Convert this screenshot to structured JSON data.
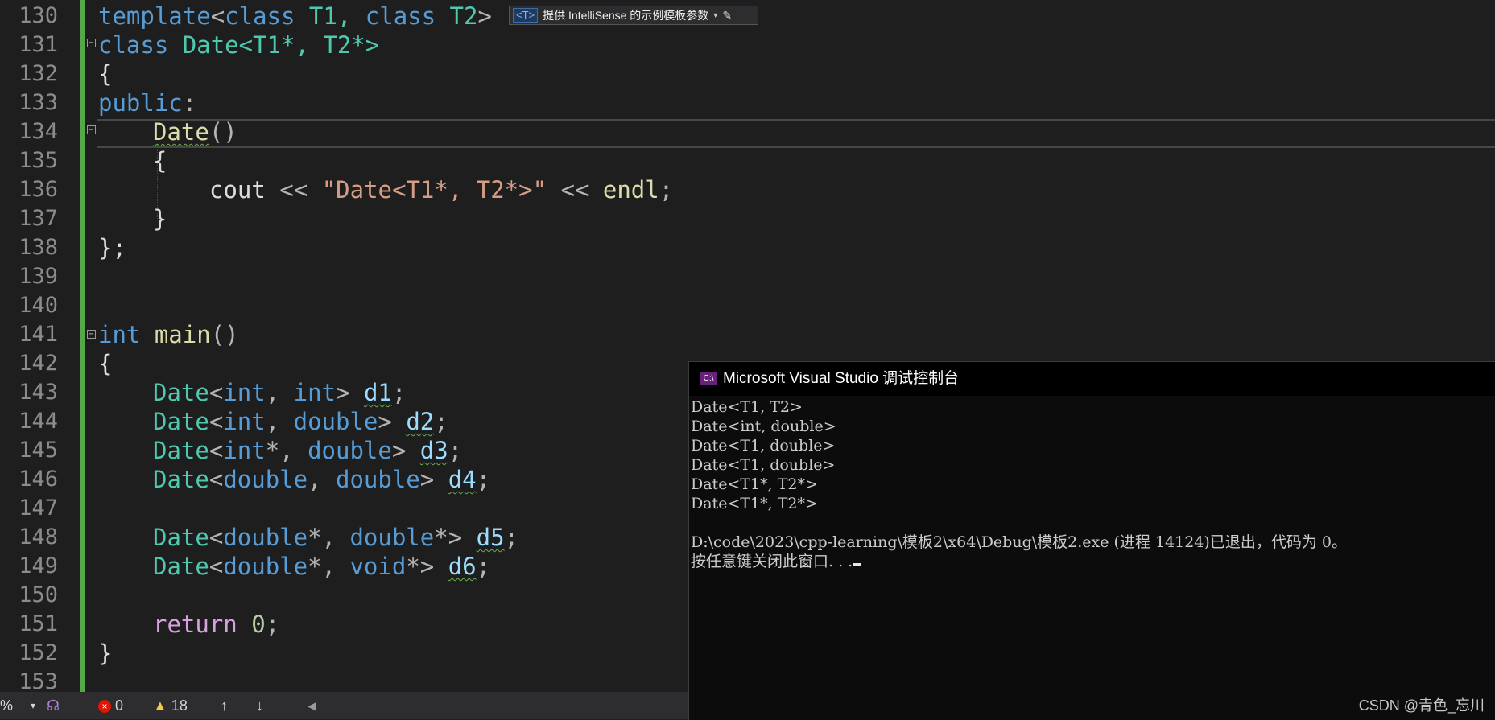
{
  "editor": {
    "line_numbers": [
      "130",
      "131",
      "132",
      "133",
      "134",
      "135",
      "136",
      "137",
      "138",
      "139",
      "140",
      "141",
      "142",
      "143",
      "144",
      "145",
      "146",
      "147",
      "148",
      "149",
      "150",
      "151",
      "152",
      "153"
    ],
    "code": {
      "l130": {
        "a": "template",
        "b": "<",
        "c": "class",
        "d": " T1, ",
        "e": "class",
        "f": " T2",
        ">": ">"
      },
      "l131": {
        "a": "class",
        "b": " Date",
        "c": "<T1*, T2*>"
      },
      "l132": "{",
      "l133": {
        "a": "public",
        "b": ":"
      },
      "l134": {
        "a": "Date",
        "b": "()"
      },
      "l135": "{",
      "l136": {
        "a": "cout",
        "b": " << ",
        "c": "\"Date<T1*, T2*>\"",
        "d": " << ",
        "e": "endl",
        "f": ";"
      },
      "l137": "}",
      "l138": "};",
      "l141": {
        "a": "int",
        "b": " main",
        "c": "()"
      },
      "l142": "{",
      "l143": {
        "a": "Date",
        "b": "<",
        "c": "int",
        "d": ", ",
        "e": "int",
        "f": "> ",
        "g": "d1",
        "h": ";"
      },
      "l144": {
        "a": "Date",
        "b": "<",
        "c": "int",
        "d": ", ",
        "e": "double",
        "f": "> ",
        "g": "d2",
        "h": ";"
      },
      "l145": {
        "a": "Date",
        "b": "<",
        "c": "int",
        "d": "*, ",
        "e": "double",
        "f": "> ",
        "g": "d3",
        "h": ";"
      },
      "l146": {
        "a": "Date",
        "b": "<",
        "c": "double",
        "d": ", ",
        "e": "double",
        "f": "> ",
        "g": "d4",
        "h": ";"
      },
      "l148": {
        "a": "Date",
        "b": "<",
        "c": "double",
        "d": "*, ",
        "e": "double",
        "f": "*> ",
        "g": "d5",
        "h": ";"
      },
      "l149": {
        "a": "Date",
        "b": "<",
        "c": "double",
        "d": "*, ",
        "e": "void",
        "f": "*> ",
        "g": "d6",
        "h": ";"
      },
      "l151": {
        "a": "return",
        "b": " ",
        "c": "0",
        "d": ";"
      },
      "l152": "}"
    },
    "hint": {
      "icon": "<T>",
      "text": "提供 IntelliSense 的示例模板参数",
      "caret": "▾",
      "edit_icon": "pencil-icon"
    }
  },
  "status_bar": {
    "zoom": "%",
    "dropdown": "▾",
    "errors": "0",
    "warnings": "18",
    "up_arrow": "↑",
    "down_arrow": "↓",
    "left_arrow": "◀"
  },
  "console": {
    "title": "Microsoft Visual Studio 调试控制台",
    "icon_text": "C:\\",
    "output": [
      "Date<T1, T2>",
      "Date<int, double>",
      "Date<T1, double>",
      "Date<T1, double>",
      "Date<T1*, T2*>",
      "Date<T1*, T2*>",
      "",
      "D:\\code\\2023\\cpp-learning\\模板2\\x64\\Debug\\模板2.exe (进程 14124)已退出，代码为 0。",
      "按任意键关闭此窗口. . ."
    ],
    "watermark": "CSDN @青色_忘川"
  },
  "colors": {
    "keyword": "#569cd6",
    "type": "#4ec9b0",
    "function": "#dcdcaa",
    "string": "#d69d85",
    "variable": "#9cdcfe",
    "number": "#b5cea8",
    "control": "#d8a0df",
    "change_bar": "#57a64a"
  }
}
